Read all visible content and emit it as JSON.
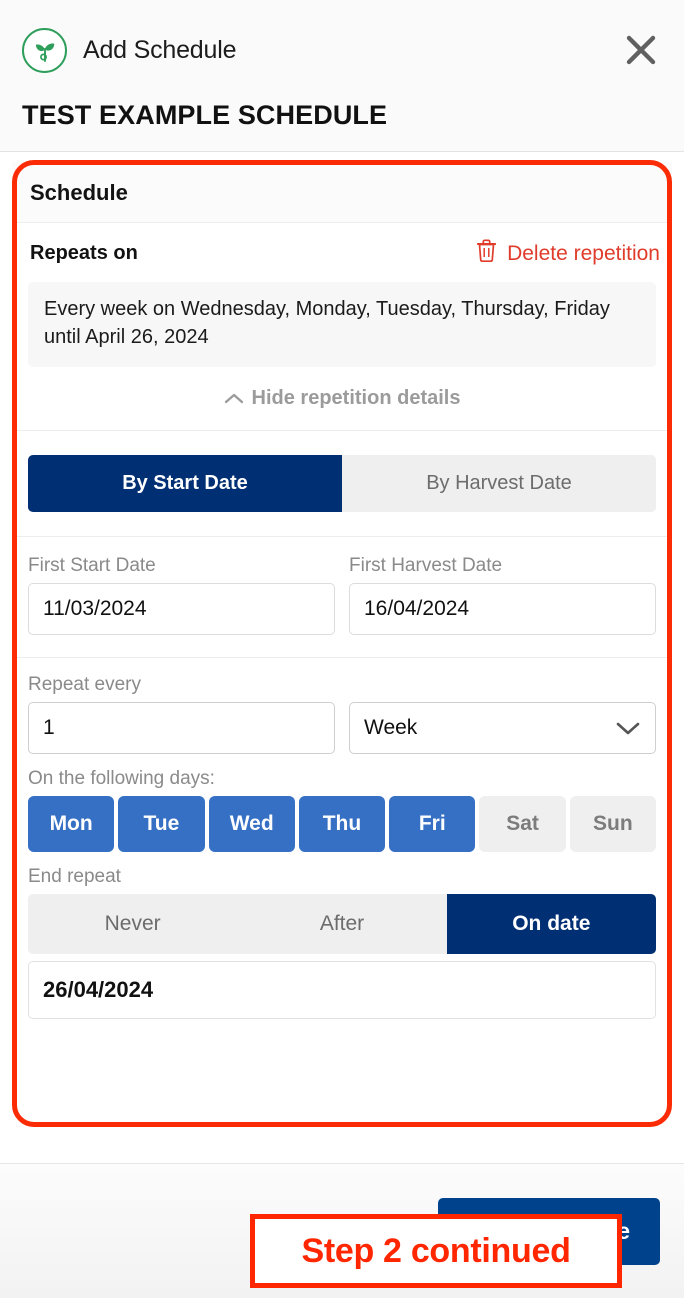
{
  "header": {
    "logo_icon": "seedling-icon",
    "title": "Add Schedule",
    "close_icon": "close-icon",
    "schedule_name": "TEST EXAMPLE SCHEDULE"
  },
  "schedule": {
    "section_title": "Schedule",
    "repeats_on_label": "Repeats on",
    "delete_repetition_label": "Delete repetition",
    "delete_icon": "trash-icon",
    "summary": "Every week on Wednesday, Monday, Tuesday, Thursday, Friday until April 26, 2024",
    "hide_details_label": "Hide repetition details",
    "hide_details_icon": "chevron-up-icon"
  },
  "date_mode_tabs": [
    {
      "label": "By Start Date",
      "active": true
    },
    {
      "label": "By Harvest Date",
      "active": false
    }
  ],
  "date_fields": [
    {
      "label": "First Start Date",
      "value": "11/03/2024"
    },
    {
      "label": "First Harvest Date",
      "value": "16/04/2024"
    }
  ],
  "repeat_every": {
    "label": "Repeat every",
    "count": "1",
    "unit": "Week",
    "unit_chevron_icon": "chevron-down-icon"
  },
  "days": {
    "label": "On the following days:",
    "items": [
      {
        "label": "Mon",
        "selected": true
      },
      {
        "label": "Tue",
        "selected": true
      },
      {
        "label": "Wed",
        "selected": true
      },
      {
        "label": "Thu",
        "selected": true
      },
      {
        "label": "Fri",
        "selected": true
      },
      {
        "label": "Sat",
        "selected": false
      },
      {
        "label": "Sun",
        "selected": false
      }
    ]
  },
  "end_repeat": {
    "label": "End repeat",
    "options": [
      {
        "label": "Never",
        "active": false
      },
      {
        "label": "After",
        "active": false
      },
      {
        "label": "On date",
        "active": true
      }
    ],
    "end_date_value": "26/04/2024"
  },
  "annotation": {
    "text": "Step 2 continued"
  },
  "footer": {
    "save_label": "Save Schedule"
  },
  "colors": {
    "navy": "#002F74",
    "save_navy": "#00438C",
    "day_blue": "#3570C4",
    "danger_red": "#E03C2B",
    "annotation_red": "#FF2600",
    "logo_green": "#2E9E5B"
  }
}
